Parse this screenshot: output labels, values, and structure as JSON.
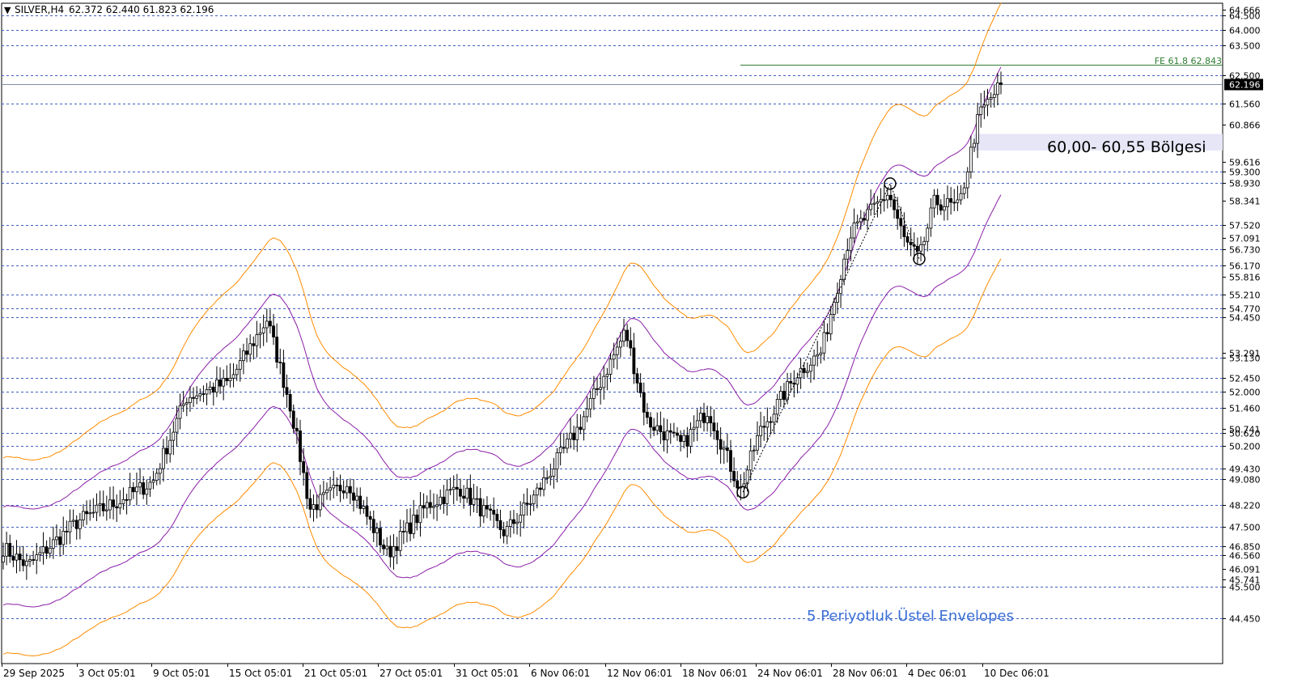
{
  "header": {
    "arrow": "▼",
    "symbol": "SILVER,H4",
    "ohlc": "62.372 62.440 61.823 62.196"
  },
  "annotations": {
    "fe_label": "FE 61.8 62.843",
    "zone_label": "60,00- 60,55 Bölgesi",
    "envelope_label": "5 Periyotluk Üstel Envelopes"
  },
  "colors": {
    "candle": "#000000",
    "envelope_inner": "#8b1fa8",
    "envelope_outer": "#ff8c00",
    "level_line": "#3f5fbf",
    "fe_line": "#2e7d32",
    "zone_fill": "#e6e6f7",
    "text_blue": "#3b6fd6",
    "price_box": "#000000"
  },
  "chart_data": {
    "type": "candlestick",
    "symbol": "SILVER",
    "timeframe": "H4",
    "ylim": [
      43.9,
      64.9
    ],
    "last_price": 62.196,
    "x_tick_labels": [
      "29 Sep 2025",
      "3 Oct 05:01",
      "9 Oct 05:01",
      "15 Oct 05:01",
      "21 Oct 05:01",
      "27 Oct 05:01",
      "31 Oct 05:01",
      "6 Nov 06:01",
      "12 Nov 06:01",
      "18 Nov 06:01",
      "24 Nov 06:01",
      "28 Nov 06:01",
      "4 Dec 06:01",
      "10 Dec 06:01"
    ],
    "levels": [
      64.5,
      64.0,
      63.5,
      62.5,
      61.56,
      59.3,
      58.93,
      57.52,
      56.73,
      56.17,
      55.21,
      54.77,
      54.45,
      53.13,
      52.45,
      52.0,
      51.46,
      50.62,
      50.2,
      49.43,
      49.08,
      48.22,
      47.5,
      46.85,
      46.56,
      45.5,
      44.45
    ],
    "scale_ticks": [
      64.666,
      60.866,
      59.616,
      58.341,
      57.091,
      55.816,
      53.291,
      50.741,
      46.091,
      45.741
    ],
    "fe_level": 62.843,
    "zone": [
      60.0,
      60.55
    ],
    "swing_points": [
      {
        "date": "20 Nov",
        "price": 48.65
      },
      {
        "date": "29 Nov",
        "price": 58.9
      },
      {
        "date": "4 Dec",
        "price": 56.4
      }
    ],
    "close_path": [
      {
        "date": "29 Sep 2025",
        "close": 46.8
      },
      {
        "date": "1 Oct",
        "close": 46.2
      },
      {
        "date": "3 Oct 05:01",
        "close": 47.7
      },
      {
        "date": "6 Oct",
        "close": 48.3
      },
      {
        "date": "9 Oct 05:01",
        "close": 49.0
      },
      {
        "date": "12 Oct",
        "close": 51.8
      },
      {
        "date": "15 Oct 05:01",
        "close": 52.3
      },
      {
        "date": "17 Oct",
        "close": 54.4
      },
      {
        "date": "19 Oct",
        "close": 51.4
      },
      {
        "date": "21 Oct 05:01",
        "close": 48.1
      },
      {
        "date": "23 Oct",
        "close": 49.0
      },
      {
        "date": "27 Oct 05:01",
        "close": 46.6
      },
      {
        "date": "29 Oct",
        "close": 48.2
      },
      {
        "date": "31 Oct 05:01",
        "close": 48.8
      },
      {
        "date": "3 Nov",
        "close": 47.3
      },
      {
        "date": "6 Nov 06:01",
        "close": 48.5
      },
      {
        "date": "9 Nov",
        "close": 50.8
      },
      {
        "date": "12 Nov 06:01",
        "close": 54.0
      },
      {
        "date": "14 Nov",
        "close": 51.0
      },
      {
        "date": "17 Nov",
        "close": 50.2
      },
      {
        "date": "18 Nov 06:01",
        "close": 51.4
      },
      {
        "date": "20 Nov",
        "close": 48.7
      },
      {
        "date": "24 Nov 06:01",
        "close": 50.6
      },
      {
        "date": "26 Nov",
        "close": 52.6
      },
      {
        "date": "27 Nov",
        "close": 53.3
      },
      {
        "date": "28 Nov 06:01",
        "close": 57.2
      },
      {
        "date": "29 Nov",
        "close": 58.6
      },
      {
        "date": "2 Dec",
        "close": 57.0
      },
      {
        "date": "4 Dec 06:01",
        "close": 56.4
      },
      {
        "date": "5 Dec",
        "close": 58.3
      },
      {
        "date": "8 Dec",
        "close": 58.1
      },
      {
        "date": "9 Dec",
        "close": 61.2
      },
      {
        "date": "10 Dec 06:01",
        "close": 62.196
      }
    ]
  }
}
